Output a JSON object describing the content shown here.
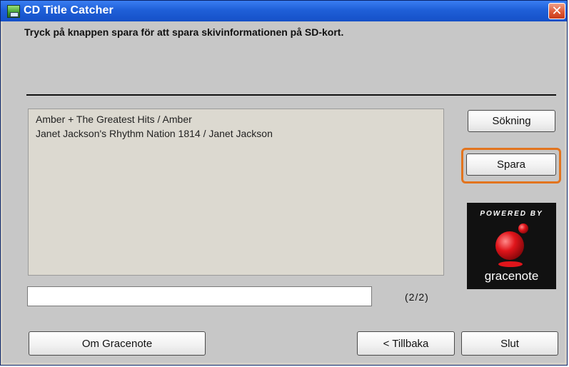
{
  "window": {
    "title": "CD Title Catcher",
    "close_label": "✕"
  },
  "instruction": "Tryck på knappen spara för att spara skivinformationen på SD-kort.",
  "results": [
    "Amber + The Greatest Hits / Amber",
    "Janet Jackson's Rhythm Nation 1814 / Janet Jackson"
  ],
  "counter": "(2/2)",
  "buttons": {
    "search": "Sökning",
    "save": "Spara",
    "about": "Om Gracenote",
    "back": "< Tillbaka",
    "end": "Slut"
  },
  "logo": {
    "powered": "POWERED BY",
    "brand": "gracenote"
  },
  "colors": {
    "titlebar": "#1f5fd8",
    "focus_ring": "#e2741e",
    "logo_ball": "#e0151b"
  },
  "icons": {
    "app": "cd-title-catcher-app-icon",
    "close": "close-icon"
  }
}
